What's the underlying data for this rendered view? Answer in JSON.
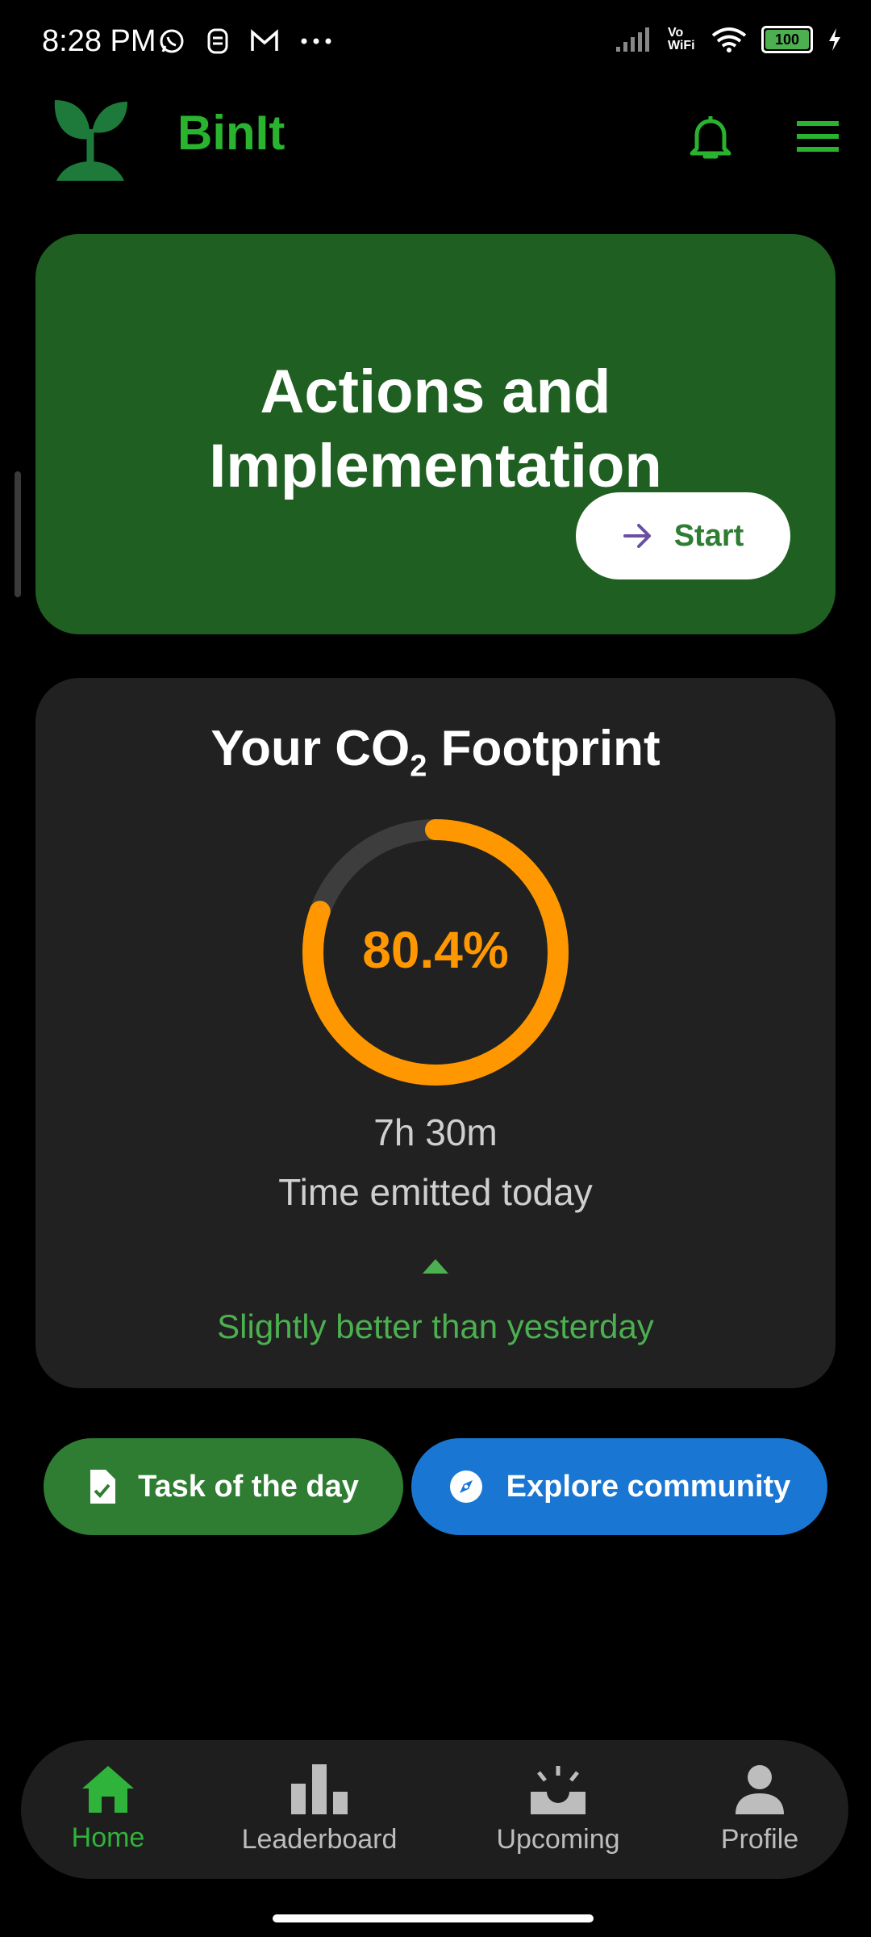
{
  "status_bar": {
    "time": "8:28 PM",
    "network_label": "Vo WiFi",
    "battery": "100"
  },
  "header": {
    "app_title": "BinIt"
  },
  "hero": {
    "title": "Actions and Implementation",
    "start_label": "Start"
  },
  "footprint": {
    "title_prefix": "Your CO",
    "title_sub": "2",
    "title_suffix": " Footprint",
    "percent": "80.4%",
    "progress_fraction": 0.804,
    "time_value": "7h 30m",
    "time_label": "Time emitted today",
    "trend_text": "Slightly better than yesterday"
  },
  "actions": {
    "task_label": "Task of the day",
    "explore_label": "Explore community"
  },
  "bottom_nav": {
    "items": [
      {
        "label": "Home",
        "icon": "home-icon"
      },
      {
        "label": "Leaderboard",
        "icon": "leaderboard-icon"
      },
      {
        "label": "Upcoming",
        "icon": "upcoming-icon"
      },
      {
        "label": "Profile",
        "icon": "profile-icon"
      }
    ]
  },
  "colors": {
    "brand_green": "#29b32f",
    "hero_green": "#1f5f21",
    "progress_orange": "#ff9800",
    "explore_blue": "#1976d2"
  }
}
